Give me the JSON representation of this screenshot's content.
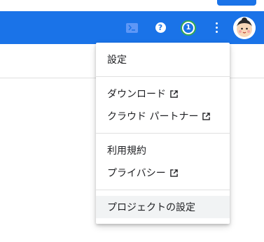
{
  "appbar": {
    "cloud_shell_icon": "terminal-icon",
    "help_icon": "help-icon",
    "notifications_count": "1",
    "more_icon": "more-vert-icon",
    "avatar_icon": "avatar-icon"
  },
  "menu": {
    "items": [
      {
        "label": "設定"
      },
      {
        "label": "ダウンロード"
      },
      {
        "label": "クラウド パートナー"
      },
      {
        "label": "利用規約"
      },
      {
        "label": "プライバシー"
      },
      {
        "label": "プロジェクトの設定"
      }
    ]
  },
  "colors": {
    "appbar": "#1a73e8",
    "menu_hover": "#f1f3f4",
    "badge_ring": "#34a853"
  }
}
